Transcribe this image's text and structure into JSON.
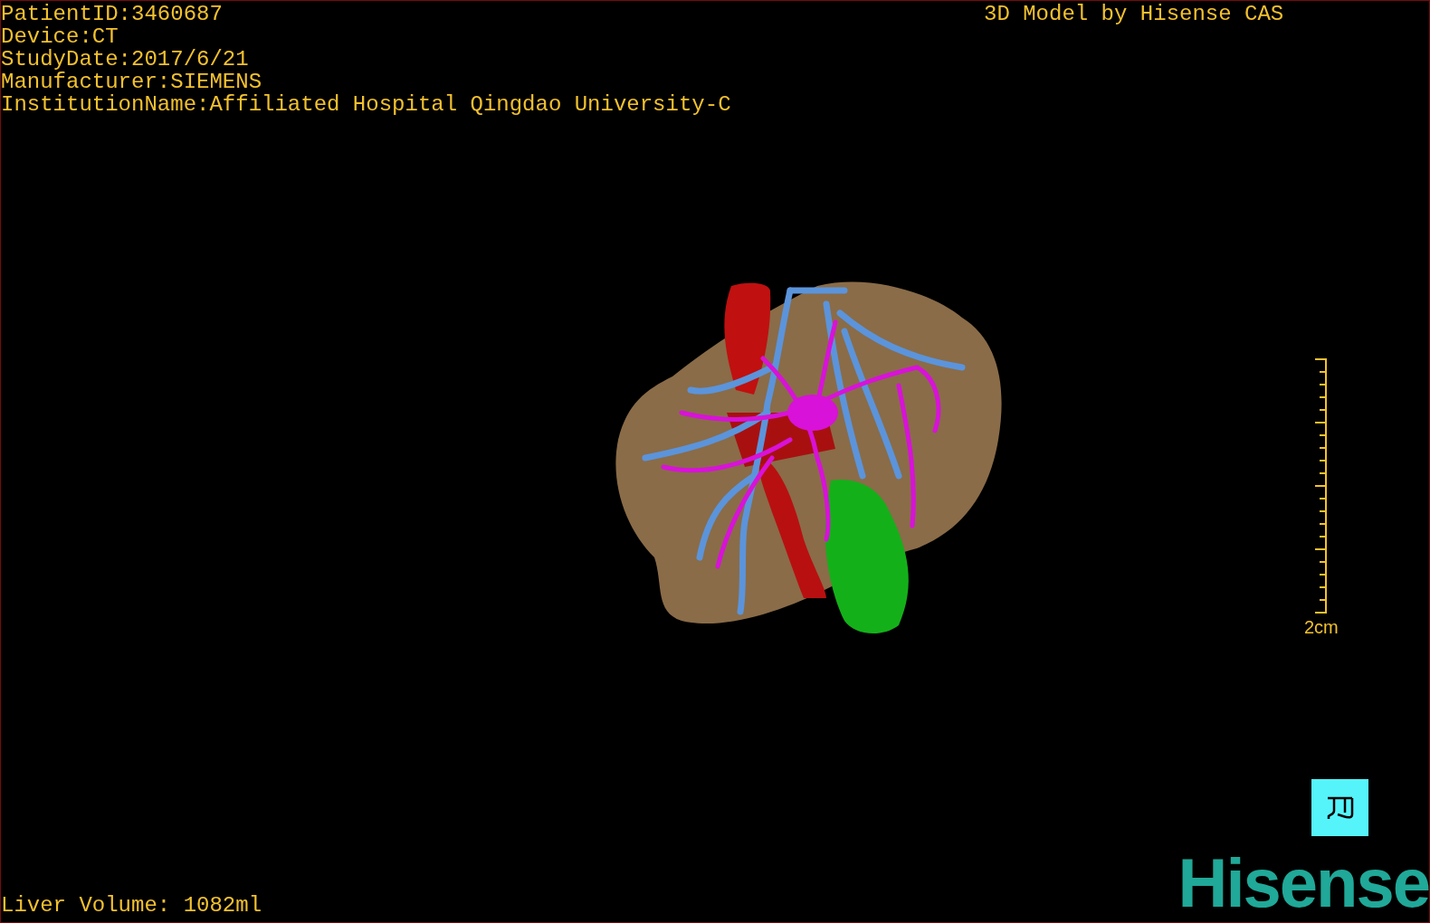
{
  "info_lines": [
    "PatientID:3460687",
    "Device:CT",
    "StudyDate:2017/6/21",
    "Manufacturer:SIEMENS",
    "InstitutionName:Affiliated Hospital Qingdao University-C"
  ],
  "title": "3D Model by Hisense CAS",
  "scale_bar": {
    "label": "2cm"
  },
  "liver_volume": "Liver Volume: 1082ml",
  "logo": "Hisense"
}
